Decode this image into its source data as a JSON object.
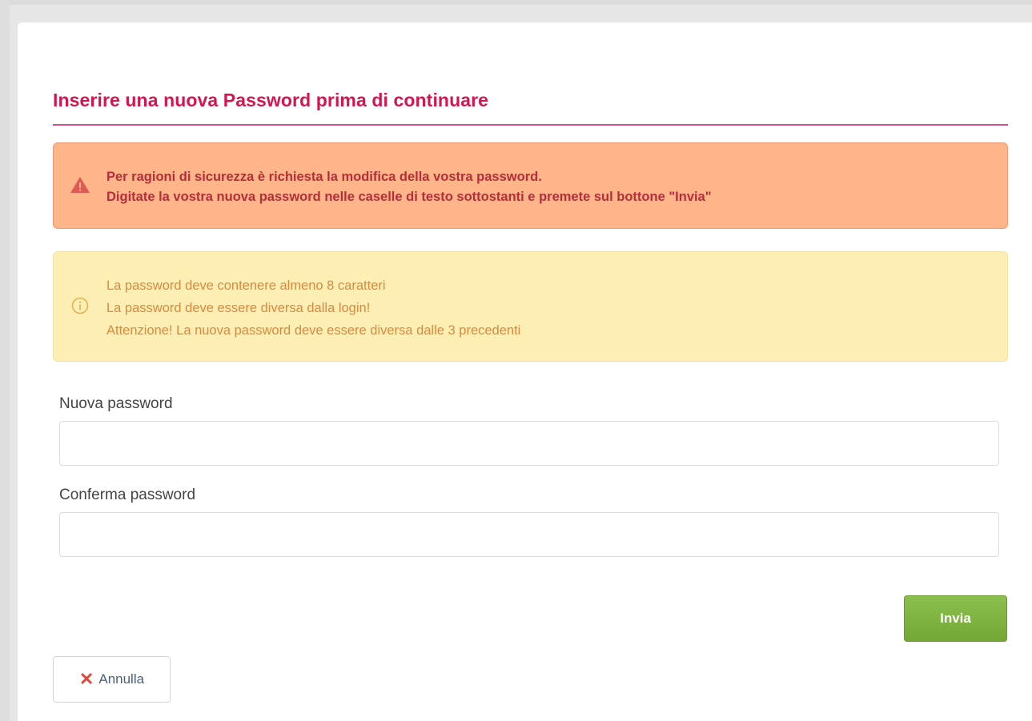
{
  "page": {
    "title": "Inserire una nuova Password prima di continuare"
  },
  "alert_danger": {
    "icon": "warning-triangle-icon",
    "line1": "Per ragioni di sicurezza è richiesta la modifica della vostra password.",
    "line2": "Digitate la vostra nuova password nelle caselle di testo sottostanti e premete sul bottone \"Invia\""
  },
  "alert_info": {
    "icon": "info-circle-icon",
    "rules": [
      "La password deve contenere almeno 8 caratteri",
      "La password deve essere diversa dalla login!",
      "Attenzione! La nuova password deve essere diversa dalle 3 precedenti"
    ]
  },
  "form": {
    "new_password_label": "Nuova password",
    "new_password_value": "",
    "confirm_password_label": "Conferma password",
    "confirm_password_value": ""
  },
  "actions": {
    "submit_label": "Invia",
    "cancel_label": "Annulla",
    "cancel_icon": "close-icon"
  },
  "colors": {
    "title": "#d6154f",
    "danger_bg": "#fdb589",
    "danger_text": "#b42f3a",
    "info_bg": "#fdefb4",
    "info_text": "#d98a41",
    "submit_bg": "#7cb342",
    "cancel_icon": "#e0483c"
  }
}
